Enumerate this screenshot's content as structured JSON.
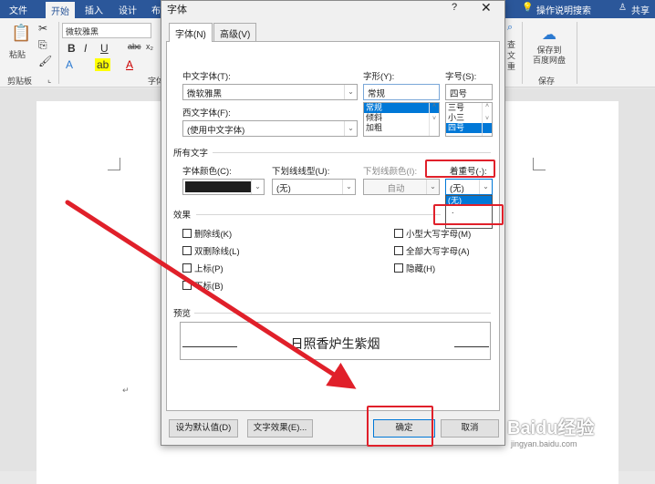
{
  "ribbon": {
    "tabs": [
      "文件",
      "开始",
      "插入",
      "设计",
      "布"
    ],
    "tell_me": "操作说明搜索",
    "share": "共享",
    "font_name": "微软雅黑",
    "groups": {
      "clipboard": "剪贴板",
      "font": "字体",
      "save": "保存"
    },
    "paste": "粘贴",
    "save_button": "保存到\n百度网盘",
    "search_chars": [
      "查",
      "文",
      "重"
    ]
  },
  "document": {
    "para_mark": "↵"
  },
  "dialog": {
    "title": "字体",
    "help": "?",
    "close": "✕",
    "tabs": [
      "字体(N)",
      "高级(V)"
    ],
    "chinese_font": {
      "label": "中文字体(T):",
      "value": "微软雅黑"
    },
    "western_font": {
      "label": "西文字体(F):",
      "value": "(使用中文字体)"
    },
    "style": {
      "label": "字形(Y):",
      "value": "常规",
      "options": [
        "常规",
        "倾斜",
        "加粗"
      ],
      "selected": "常规"
    },
    "size": {
      "label": "字号(S):",
      "value": "四号",
      "options": [
        "三号",
        "小三",
        "四号"
      ],
      "selected": "四号"
    },
    "all_text": "所有文字",
    "font_color": {
      "label": "字体颜色(C):",
      "value": "#1e1e1e"
    },
    "underline_style": {
      "label": "下划线线型(U):",
      "value": "(无)"
    },
    "underline_color": {
      "label": "下划线颜色(I):",
      "value": "自动"
    },
    "emphasis": {
      "label": "着重号(·):",
      "value": "(无)",
      "options": [
        "(无)",
        "."
      ],
      "selected": "(无)"
    },
    "effects": {
      "label": "效果",
      "left": [
        "删除线(K)",
        "双删除线(L)",
        "上标(P)",
        "下标(B)"
      ],
      "right": [
        "小型大写字母(M)",
        "全部大写字母(A)",
        "隐藏(H)"
      ]
    },
    "preview": {
      "label": "预览",
      "text": "日照香炉生紫烟"
    },
    "buttons": {
      "default": "设为默认值(D)",
      "text_effects": "文字效果(E)...",
      "ok": "确定",
      "cancel": "取消"
    }
  },
  "watermark": {
    "brand": "Baidu经验",
    "url": "jingyan.baidu.com"
  },
  "colors": {
    "annotation": "#e0202a",
    "ribbon_blue": "#2b579a",
    "highlight": "#0078d7"
  }
}
